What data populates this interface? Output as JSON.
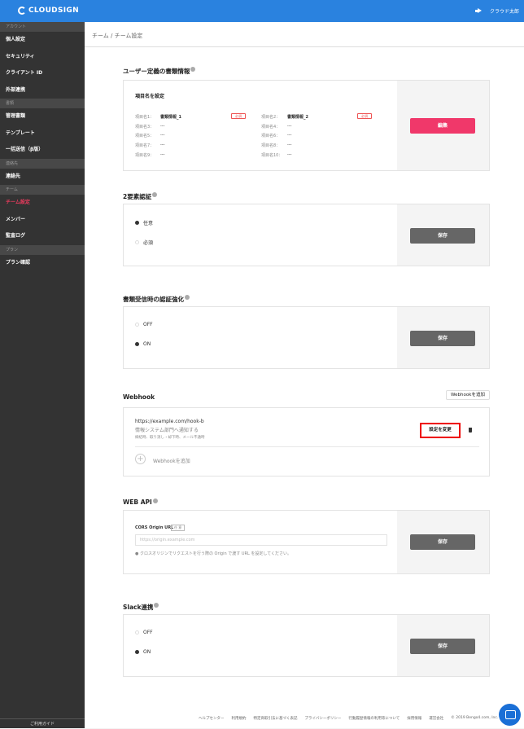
{
  "header": {
    "logo": "CLOUDSIGN",
    "user": "クラウド太郎"
  },
  "sidebar": {
    "s1": "アカウント",
    "i1": "個人設定",
    "i2": "セキュリティ",
    "i3": "クライアント ID",
    "i4": "外部連携",
    "s2": "書類",
    "i5": "管理書類",
    "i6": "テンプレート",
    "i7": "一括送信（β版）",
    "s3": "連絡先",
    "i8": "連絡先",
    "s4": "チーム",
    "i9": "チーム設定",
    "i10": "メンバー",
    "i11": "監査ログ",
    "s5": "プラン",
    "i12": "プラン確認",
    "guide": "ご利用ガイド"
  },
  "breadcrumb": "チーム / チーム設定",
  "custom": {
    "title": "ユーザー定義の書類情報",
    "panel": "項目名を設定",
    "l1": "項目名1：",
    "v1": "書類情報_1",
    "l2": "項目名2：",
    "v2": "書類情報_2",
    "req": "必須",
    "l3": "項目名3：",
    "l4": "項目名4：",
    "l5": "項目名5：",
    "l6": "項目名6：",
    "l7": "項目名7：",
    "l8": "項目名8：",
    "l9": "項目名9：",
    "l10": "項目名10：",
    "dash": "---",
    "edit": "編集"
  },
  "twofa": {
    "title": "2要素認証",
    "o1": "任意",
    "o2": "必須",
    "save": "保存"
  },
  "recv": {
    "title": "書類受信時の認証強化",
    "o1": "OFF",
    "o2": "ON",
    "save": "保存"
  },
  "webhook": {
    "title": "Webhook",
    "add_top": "Webhookを追加",
    "url": "https://example.com/hook-b",
    "desc": "情報システム部門へ通知する",
    "events": "締結時、取り消し・却下時、メール不通時",
    "change": "設定を変更",
    "add": "Webhookを追加"
  },
  "api": {
    "title": "WEB API",
    "label": "CORS Origin URL",
    "opt": "任 意",
    "placeholder": "https://origin.example.com",
    "note": "クロスオリジンでリクエストを行う際の Origin で渡す URL を設定してください。",
    "save": "保存"
  },
  "slack": {
    "title": "Slack連携",
    "o1": "OFF",
    "o2": "ON",
    "save": "保存"
  },
  "footer": {
    "f1": "ヘルプセンター",
    "f2": "利用規約",
    "f3": "特定商取引法に基づく表記",
    "f4": "プライバシーポリシー",
    "f5": "行動履歴情報の利用等について",
    "f6": "採用情報",
    "f7": "運営会社",
    "f8": "© 2019 Bengo4.com, Inc."
  }
}
